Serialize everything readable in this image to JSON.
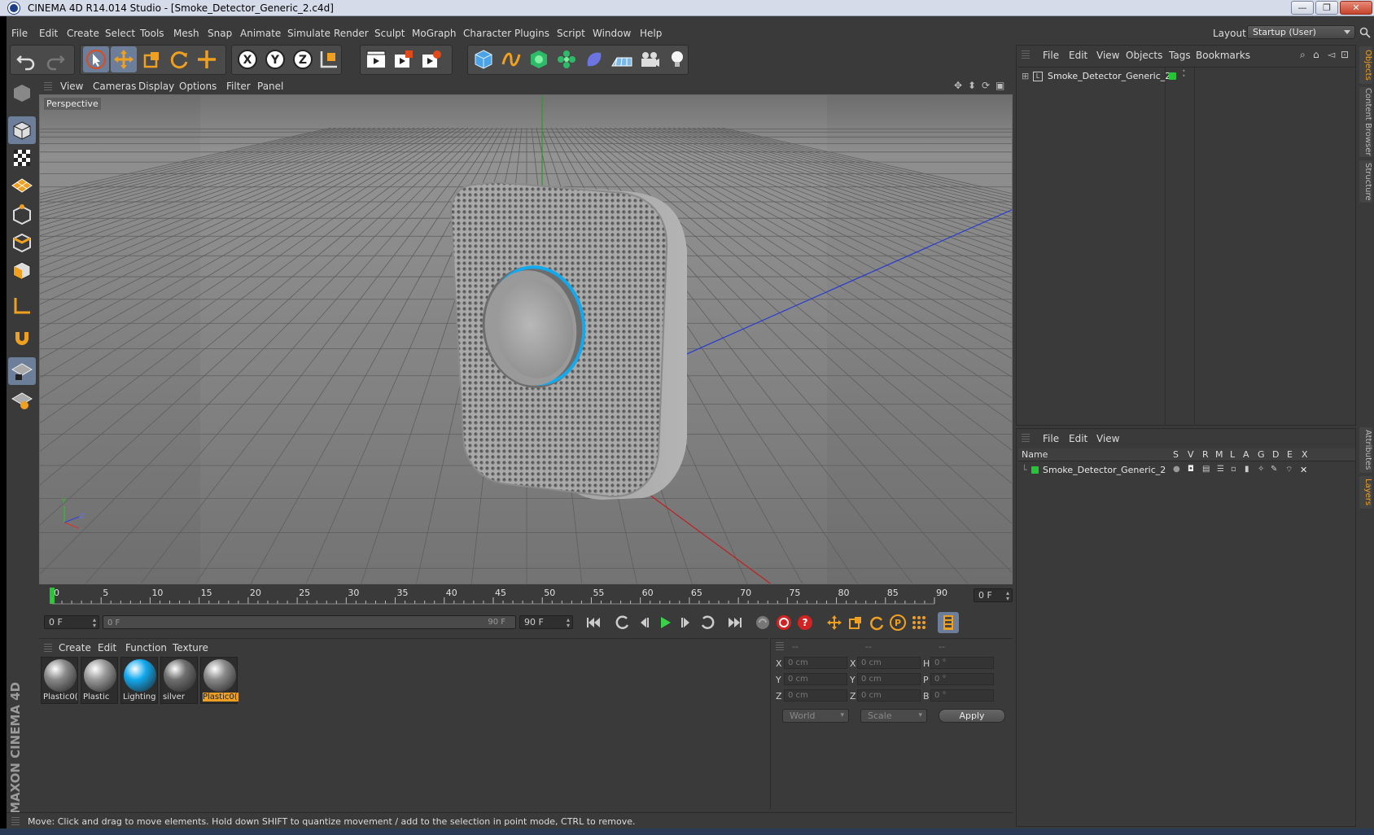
{
  "window": {
    "title": "CINEMA 4D R14.014 Studio - [Smoke_Detector_Generic_2.c4d]",
    "min": "—",
    "max": "❐",
    "close": "✕"
  },
  "menubar": {
    "items": [
      "File",
      "Edit",
      "Create",
      "Select",
      "Tools",
      "Mesh",
      "Snap",
      "Animate",
      "Simulate",
      "Render",
      "Sculpt",
      "MoGraph",
      "Character",
      "Plugins",
      "Script",
      "Window",
      "Help"
    ],
    "layout_label": "Layout:",
    "layout_value": "Startup (User)"
  },
  "viewport": {
    "menu": [
      "View",
      "Cameras",
      "Display",
      "Options",
      "Filter",
      "Panel"
    ],
    "label": "Perspective"
  },
  "timeline": {
    "ticks": [
      "0",
      "5",
      "10",
      "15",
      "20",
      "25",
      "30",
      "35",
      "40",
      "45",
      "50",
      "55",
      "60",
      "65",
      "70",
      "75",
      "80",
      "85",
      "90"
    ],
    "current_frame": "0 F",
    "start_frame": "0 F",
    "range_start": "0 F",
    "range_end": "90 F",
    "end_frame": "90 F"
  },
  "materials": {
    "menu": [
      "Create",
      "Edit",
      "Function",
      "Texture"
    ],
    "items": [
      {
        "name": "Plastic0(",
        "color": "#8a8a8a",
        "selected": false
      },
      {
        "name": "Plastic",
        "color": "#9a9a9a",
        "selected": false
      },
      {
        "name": "Lighting",
        "color": "#13a9ee",
        "selected": false
      },
      {
        "name": "silver",
        "color": "#707070",
        "selected": false
      },
      {
        "name": "Plastic0(",
        "color": "#8a8a8a",
        "selected": true
      }
    ]
  },
  "coordinates": {
    "headers": [
      "--",
      "--",
      "--"
    ],
    "rows": [
      {
        "l1": "X",
        "v1": "0 cm",
        "l2": "X",
        "v2": "0 cm",
        "l3": "H",
        "v3": "0 °"
      },
      {
        "l1": "Y",
        "v1": "0 cm",
        "l2": "Y",
        "v2": "0 cm",
        "l3": "P",
        "v3": "0 °"
      },
      {
        "l1": "Z",
        "v1": "0 cm",
        "l2": "Z",
        "v2": "0 cm",
        "l3": "B",
        "v3": "0 °"
      }
    ],
    "world": "World",
    "scale": "Scale",
    "apply": "Apply"
  },
  "object_manager": {
    "menu": [
      "File",
      "Edit",
      "View",
      "Objects",
      "Tags",
      "Bookmarks"
    ],
    "object_name": "Smoke_Detector_Generic_2"
  },
  "layer_manager": {
    "menu": [
      "File",
      "Edit",
      "View"
    ],
    "columns": [
      "Name",
      "S",
      "V",
      "R",
      "M",
      "L",
      "A",
      "G",
      "D",
      "E",
      "X"
    ],
    "layer_name": "Smoke_Detector_Generic_2"
  },
  "side_tabs": [
    "Objects",
    "Content Browser",
    "Structure",
    "Attributes",
    "Layers"
  ],
  "status": {
    "message": "Move: Click and drag to move elements. Hold down SHIFT to quantize movement / add to the selection in point mode, CTRL to remove."
  },
  "branding": "MAXON CINEMA 4D",
  "colors": {
    "accent": "#f0a020",
    "selection": "#6c7e99",
    "layer_green": "#27c43a",
    "light_ring": "#13a9ee"
  }
}
